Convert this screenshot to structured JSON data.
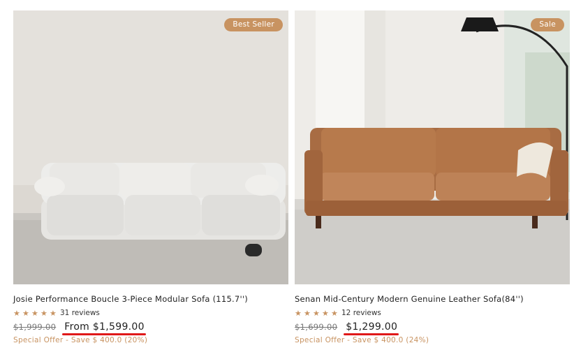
{
  "colors": {
    "accent": "#c89361",
    "highlight": "#e01919"
  },
  "products": [
    {
      "badge": "Best Seller",
      "title": "Josie Performance Boucle 3-Piece Modular Sofa (115.7'')",
      "rating": 5,
      "reviews": "31 reviews",
      "old_price": "$1,999.00",
      "new_price": "From $1,599.00",
      "offer": "Special Offer - Save $ 400.0 (20%)"
    },
    {
      "badge": "Sale",
      "title": "Senan Mid-Century Modern Genuine Leather Sofa(84'')",
      "rating": 5,
      "reviews": "12 reviews",
      "old_price": "$1,699.00",
      "new_price": "$1,299.00",
      "offer": "Special Offer - Save $ 400.0 (24%)"
    }
  ]
}
